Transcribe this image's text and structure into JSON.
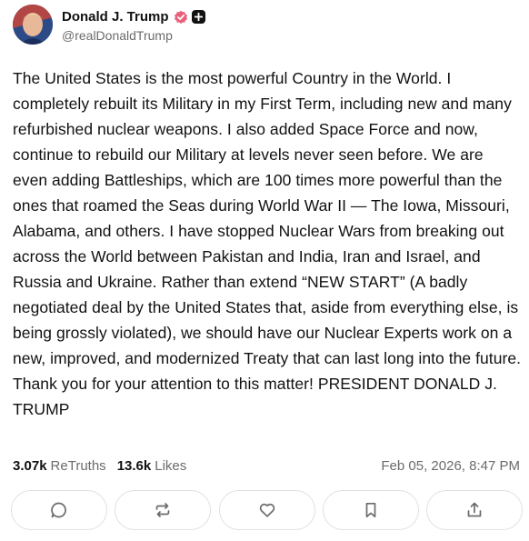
{
  "author": {
    "display_name": "Donald J. Trump",
    "handle": "@realDonaldTrump",
    "avatar_icon": "avatar-portrait",
    "verified_icon": "verified-badge-icon",
    "verified_color": "#e8607a",
    "plus_icon": "plus-icon"
  },
  "post": {
    "text": "The United States is the most powerful Country in the World. I completely rebuilt its Military in my First Term, including new and many refurbished nuclear weapons. I also added Space Force and now, continue to rebuild our Military at levels never seen before. We are even adding Battleships, which are 100 times more powerful than the ones that roamed the Seas during World War II — The Iowa, Missouri, Alabama, and others. I have stopped Nuclear Wars from breaking out across the World between Pakistan and India, Iran and Israel, and Russia and Ukraine. Rather than extend “NEW START” (A badly negotiated deal by the United States that, aside from everything else, is being grossly violated), we should have our Nuclear Experts work on a new, improved, and modernized Treaty that can last long into the future. Thank you for your attention to this matter! PRESIDENT DONALD J. TRUMP"
  },
  "stats": {
    "retruths_count": "3.07k",
    "retruths_label": "ReTruths",
    "likes_count": "13.6k",
    "likes_label": "Likes",
    "timestamp": "Feb 05, 2026, 8:47 PM"
  },
  "actions": [
    {
      "icon": "reply-icon"
    },
    {
      "icon": "retruth-icon"
    },
    {
      "icon": "like-icon"
    },
    {
      "icon": "bookmark-icon"
    },
    {
      "icon": "share-icon"
    }
  ],
  "colors": {
    "text": "#111111",
    "muted": "#6b6b6b",
    "border": "#e1e1e1",
    "icon": "#6b6b6b"
  }
}
